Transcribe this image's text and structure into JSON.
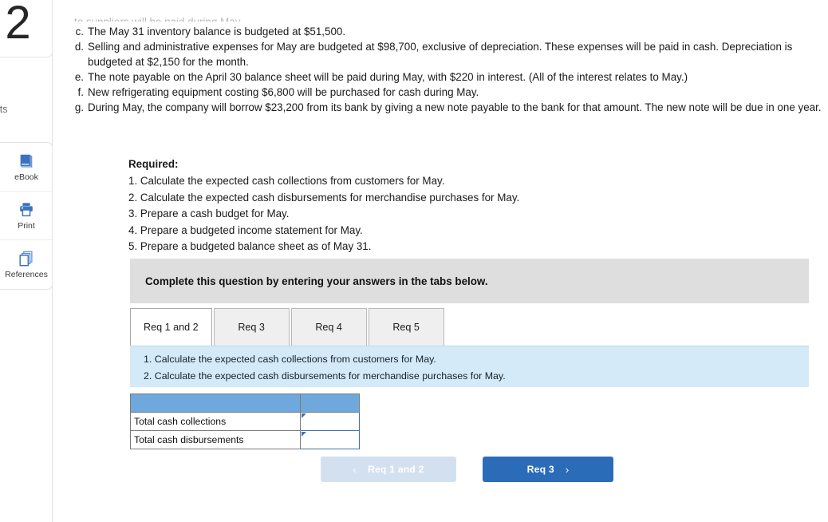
{
  "sidebar": {
    "question_number": "2",
    "points_label": "ints",
    "tools": [
      {
        "label": "eBook",
        "icon": "ebook-icon"
      },
      {
        "label": "Print",
        "icon": "print-icon"
      },
      {
        "label": "References",
        "icon": "references-icon"
      }
    ]
  },
  "problem": {
    "cut_off_line": "to suppliers will be paid during May.",
    "items": [
      {
        "marker": "c.",
        "text": "The May 31 inventory balance is budgeted at $51,500."
      },
      {
        "marker": "d.",
        "text": "Selling and administrative expenses for May are budgeted at $98,700, exclusive of depreciation. These expenses will be paid in cash. Depreciation is budgeted at $2,150 for the month."
      },
      {
        "marker": "e.",
        "text": "The note payable on the April 30 balance sheet will be paid during May, with $220 in interest. (All of the interest relates to May.)"
      },
      {
        "marker": "f.",
        "text": "New refrigerating equipment costing $6,800 will be purchased for cash during May."
      },
      {
        "marker": "g.",
        "text": "During May, the company will borrow $23,200 from its bank by giving a new note payable to the bank for that amount. The new note will be due in one year."
      }
    ]
  },
  "required": {
    "title": "Required:",
    "items": [
      "1. Calculate the expected cash collections from customers for May.",
      "2. Calculate the expected cash disbursements for merchandise purchases for May.",
      "3. Prepare a cash budget for May.",
      "4. Prepare a budgeted income statement for May.",
      "5. Prepare a budgeted balance sheet as of May 31."
    ]
  },
  "banner": {
    "text": "Complete this question by entering your answers in the tabs below."
  },
  "tabs": [
    {
      "label": "Req 1 and 2",
      "active": true
    },
    {
      "label": "Req 3",
      "active": false
    },
    {
      "label": "Req 4",
      "active": false
    },
    {
      "label": "Req 5",
      "active": false
    }
  ],
  "tab_panel": {
    "lines": [
      "1. Calculate the expected cash collections from customers for May.",
      "2. Calculate the expected cash disbursements for merchandise purchases for May."
    ]
  },
  "answer_table": {
    "header": [
      "",
      ""
    ],
    "rows": [
      {
        "label": "Total cash collections",
        "value": ""
      },
      {
        "label": "Total cash disbursements",
        "value": ""
      }
    ]
  },
  "nav": {
    "prev_label": "Req 1 and 2",
    "prev_chevron": "‹",
    "next_label": "Req 3",
    "next_chevron": "›"
  },
  "colors": {
    "banner_gray": "#DEDEDE",
    "panel_blue": "#D4EAF8",
    "table_header_blue": "#6FA8DC",
    "next_button_blue": "#2B6CB8",
    "prev_button_blue": "#D3E0F0",
    "input_border_blue": "#3F72AD",
    "icon_blue": "#3C72BD"
  }
}
